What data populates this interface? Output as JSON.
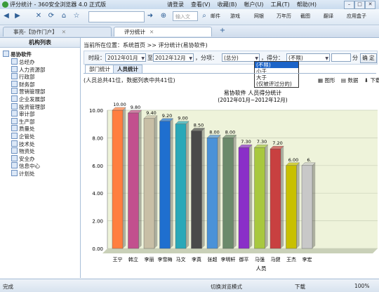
{
  "window": {
    "title": "评分统计 - 360安全浏览器 4.0 正式版",
    "menus": [
      "请登录",
      "查看(V)",
      "收藏(B)",
      "帐户(U)",
      "工具(T)",
      "帮助(H)"
    ]
  },
  "toolbar": {
    "search_placeholder": "输入文",
    "links": [
      "邮件",
      "游戏",
      "网银",
      "万年历",
      "截图",
      "翻译",
      "应用盒子"
    ]
  },
  "tabs": [
    {
      "label": "事亮-【协作门户】"
    },
    {
      "label": "评分统计"
    }
  ],
  "sidebar": {
    "title": "机构列表",
    "root": "易协软件",
    "items": [
      "总经办",
      "人力资源部",
      "行政部",
      "财务部",
      "营销管理部",
      "企业发展部",
      "投资管理部",
      "审计部",
      "生产部",
      "质量处",
      "企管处",
      "技术处",
      "物资处",
      "安全办",
      "信息中心",
      "计划处"
    ]
  },
  "breadcrumb": "当前所在位置：系统首页 >> 评分统计(易协软件)",
  "filter": {
    "period_label": "时段：",
    "from": "2012年01月",
    "to_label": "至",
    "to": "2012年12月",
    "item_label": "，分项：",
    "item_value": "(总分)",
    "score_label": "，得分：",
    "score_value": "(不限)",
    "unit": "分",
    "confirm": "确 定",
    "options": [
      "(不限)",
      "小于",
      "大于",
      "(仅被评过分的)"
    ]
  },
  "subtabs": [
    "部门统计",
    "人员统计"
  ],
  "summary": "(人员总共41位，数据列表中共41位)",
  "view_buttons": [
    "图形",
    "数据",
    "下载"
  ],
  "colors": {
    "accent": "#1c64c8",
    "bar_top": "#f0f4f8"
  },
  "chart_data": {
    "type": "bar",
    "title": "易协软件 人员得分统计",
    "subtitle": "(2012年01月~2012年12月)",
    "xlabel": "人员",
    "ylabel": "",
    "ylim": [
      0,
      10
    ],
    "yticks": [
      "0.00",
      "2.00",
      "4.00",
      "6.00",
      "8.00",
      "10.00"
    ],
    "categories": [
      "王宁",
      "韩立",
      "李丽",
      "李雪梅",
      "马文",
      "李真",
      "张超",
      "李明轩",
      "御平",
      "马强",
      "马健",
      "王杰",
      "李宏"
    ],
    "values": [
      10.0,
      9.8,
      9.4,
      9.2,
      9.0,
      8.5,
      8.0,
      8.0,
      7.3,
      7.3,
      7.2,
      6.0,
      6.0
    ],
    "value_labels": [
      "10.00",
      "9.80",
      "9.40",
      "9.20",
      "9.00",
      "8.50",
      "8.00",
      "8.00",
      "7.30",
      "7.30",
      "7.20",
      "6.00",
      "6."
    ],
    "colors": [
      "#ff7f3f",
      "#c2508e",
      "#c8bfa6",
      "#1f6fcf",
      "#2aa8b8",
      "#4a4a4a",
      "#4a92d8",
      "#6b8a6b",
      "#8a2fc8",
      "#a8c83e",
      "#c84040",
      "#c8c000",
      "#c8c8c8"
    ]
  },
  "status": {
    "left": "完成",
    "mode": "切换浏览模式",
    "download": "下载",
    "zoom": "100%"
  }
}
